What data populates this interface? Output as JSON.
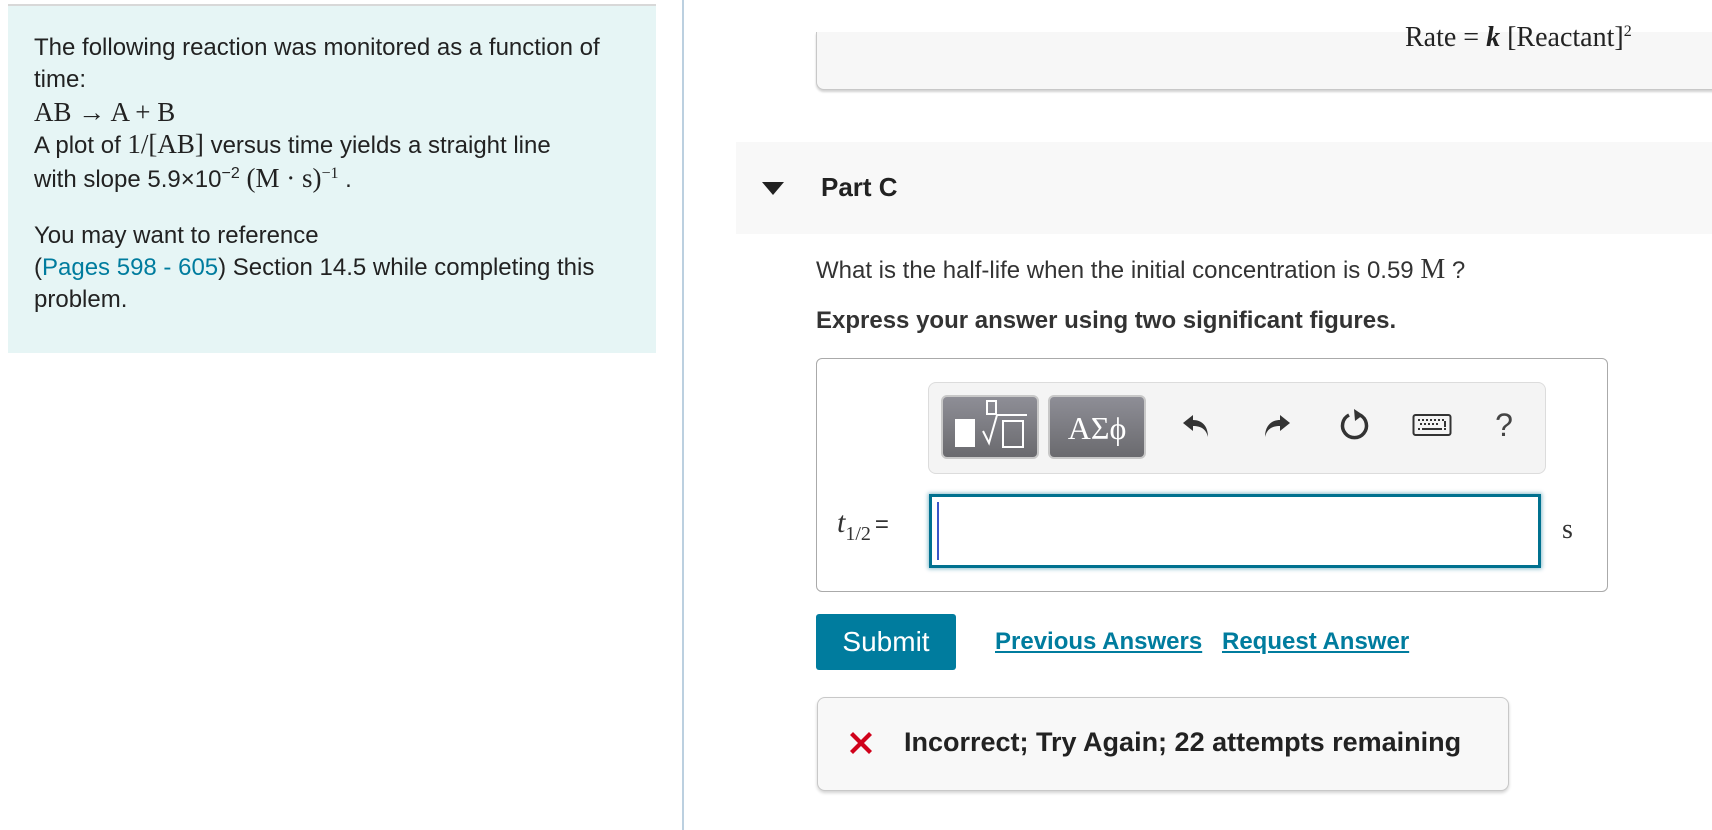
{
  "intro": {
    "line1": "The following reaction was monitored as a function of time:",
    "reaction": "AB → A + B",
    "plot_prefix": "A plot of ",
    "plot_math": "1/[AB]",
    "plot_suffix": " versus time yields a straight line",
    "slope_prefix": "with slope ",
    "slope_mantissa": "5.9×10",
    "slope_exponent": "−2",
    "slope_units": " (M · s)",
    "slope_units_exponent": "−1",
    "slope_end": " .",
    "reference_line1": "You may want to reference",
    "reference_open": "(",
    "reference_link": "Pages 598 - 605",
    "reference_rest": ") Section 14.5 while completing this problem."
  },
  "previous_part": {
    "formula": "Rate = ",
    "formula_k": "k",
    "formula_rest": " [Reactant]",
    "formula_exponent": "2"
  },
  "part": {
    "title": "Part C",
    "question_prefix": "What is the half-life when the initial concentration is 0.59 ",
    "question_unit": "M",
    "question_suffix": " ?",
    "instruction": "Express your answer using two significant figures."
  },
  "toolbar": {
    "symbols_label": "ΑΣϕ",
    "help_label": "?"
  },
  "answer": {
    "variable": "t",
    "variable_sub": "1/2",
    "equals": "=",
    "value": "",
    "unit": "s"
  },
  "actions": {
    "submit": "Submit",
    "previous_answers": "Previous Answers",
    "request_answer": "Request Answer"
  },
  "feedback": {
    "message": "Incorrect; Try Again; 22 attempts remaining",
    "color": "#d0021b"
  }
}
